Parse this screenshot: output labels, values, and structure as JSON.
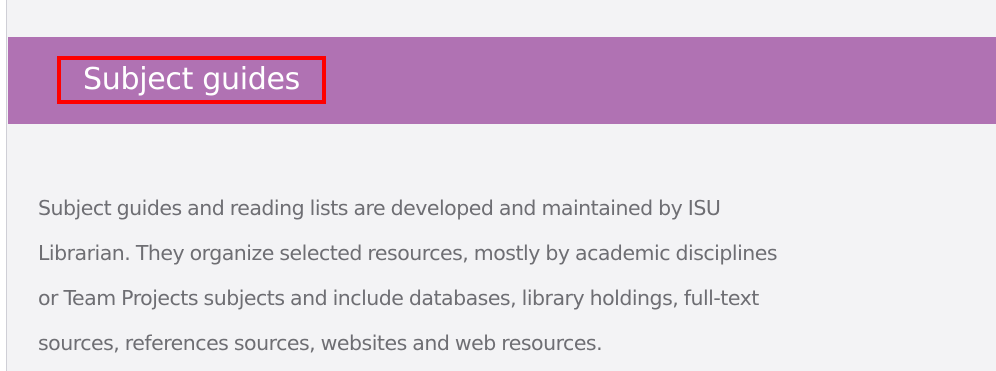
{
  "panel": {
    "title": "Subject guides",
    "description_lines": [
      "Subject guides and reading lists are developed and maintained by ISU",
      "Librarian. They organize selected resources, mostly by academic disciplines",
      "or Team Projects subjects and include databases, library holdings, full-text",
      "sources, references sources, websites and web resources."
    ]
  },
  "colors": {
    "header_background": "#b072b3",
    "highlight_border": "#ff0000",
    "body_background": "#f3f3f5",
    "body_text": "#6e6e73"
  }
}
